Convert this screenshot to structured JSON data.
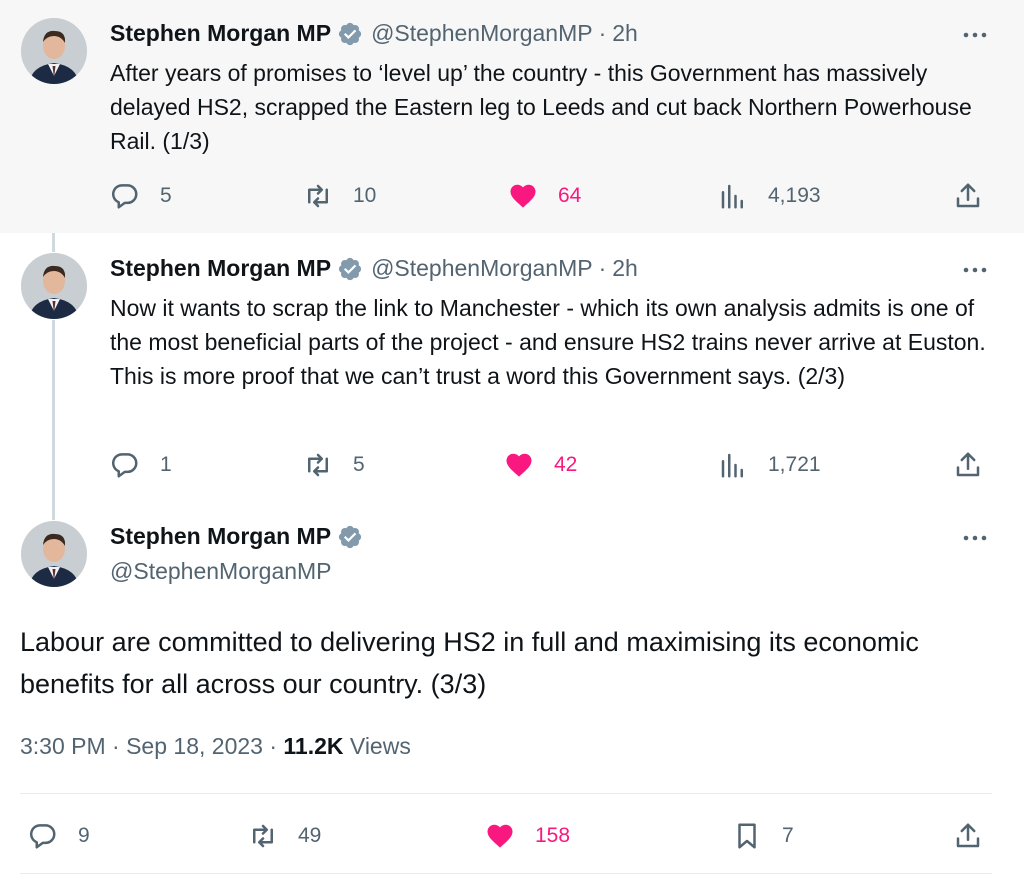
{
  "author": {
    "name": "Stephen Morgan MP",
    "handle": "@StephenMorganMP"
  },
  "tweets": [
    {
      "time": "2h",
      "text": "After years of promises to ‘level up’ the country - this Government has massively delayed HS2, scrapped the Eastern leg to Leeds and cut back Northern Powerhouse Rail. (1/3)",
      "replies": "5",
      "retweets": "10",
      "likes": "64",
      "views": "4,193"
    },
    {
      "time": "2h",
      "text": "Now it wants to scrap the link to Manchester - which its own analysis admits is one of the most beneficial parts of the project - and ensure HS2 trains never arrive at Euston. This is more proof that we can’t trust a word this Government says. (2/3)",
      "replies": "1",
      "retweets": "5",
      "likes": "42",
      "views": "1,721"
    }
  ],
  "main_tweet": {
    "text": "Labour are committed to delivering HS2 in full and maximising its economic benefits for all across our country. (3/3)",
    "timestamp": "3:30 PM · Sep 18, 2023 · ",
    "views_count": "11.2K",
    "views_label": " Views",
    "replies": "9",
    "retweets": "49",
    "likes": "158",
    "bookmarks": "7"
  },
  "icons": {
    "reply": "reply-icon",
    "retweet": "retweet-icon",
    "like": "heart-icon",
    "views": "views-icon",
    "share": "share-icon",
    "bookmark": "bookmark-icon",
    "verified": "verified-badge-icon",
    "more": "more-icon"
  },
  "colors": {
    "like": "#f91880",
    "secondary_text": "#536471",
    "verified_badge": "#829aab",
    "thread_line": "#cfd9de"
  }
}
